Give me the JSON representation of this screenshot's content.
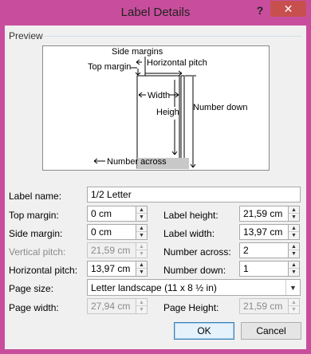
{
  "window": {
    "title": "Label Details",
    "help_glyph": "?",
    "close_glyph": "✕"
  },
  "preview": {
    "legend": "Preview",
    "labels": {
      "side_margins": "Side margins",
      "top_margin": "Top margin",
      "horizontal_pitch": "Horizontal pitch",
      "width": "Width",
      "height": "Heigh",
      "number_down": "Number down",
      "number_across": "Number across"
    }
  },
  "form": {
    "label_name": {
      "label": "Label name:",
      "value": "1/2 Letter"
    },
    "top_margin": {
      "label": "Top margin:",
      "value": "0 cm"
    },
    "side_margin": {
      "label": "Side margin:",
      "value": "0 cm"
    },
    "vertical_pitch": {
      "label": "Vertical pitch:",
      "value": "21,59 cm"
    },
    "horizontal_pitch": {
      "label": "Horizontal pitch:",
      "value": "13,97 cm"
    },
    "label_height": {
      "label": "Label height:",
      "value": "21,59 cm"
    },
    "label_width": {
      "label": "Label width:",
      "value": "13,97 cm"
    },
    "number_across": {
      "label": "Number across:",
      "value": "2"
    },
    "number_down": {
      "label": "Number down:",
      "value": "1"
    },
    "page_size": {
      "label": "Page size:",
      "value": "Letter landscape (11 x 8 ½ in)"
    },
    "page_width": {
      "label": "Page width:",
      "value": "27,94 cm"
    },
    "page_height": {
      "label": "Page Height:",
      "value": "21,59 cm"
    }
  },
  "buttons": {
    "ok": "OK",
    "cancel": "Cancel"
  },
  "icons": {
    "spin_up": "spin-up-arrow-icon",
    "spin_down": "spin-down-arrow-icon",
    "dropdown": "chevron-down-icon"
  },
  "colors": {
    "title_bar": "#c84e9d",
    "close_button": "#c7504f",
    "dialog_background": "#f0f0f0"
  }
}
